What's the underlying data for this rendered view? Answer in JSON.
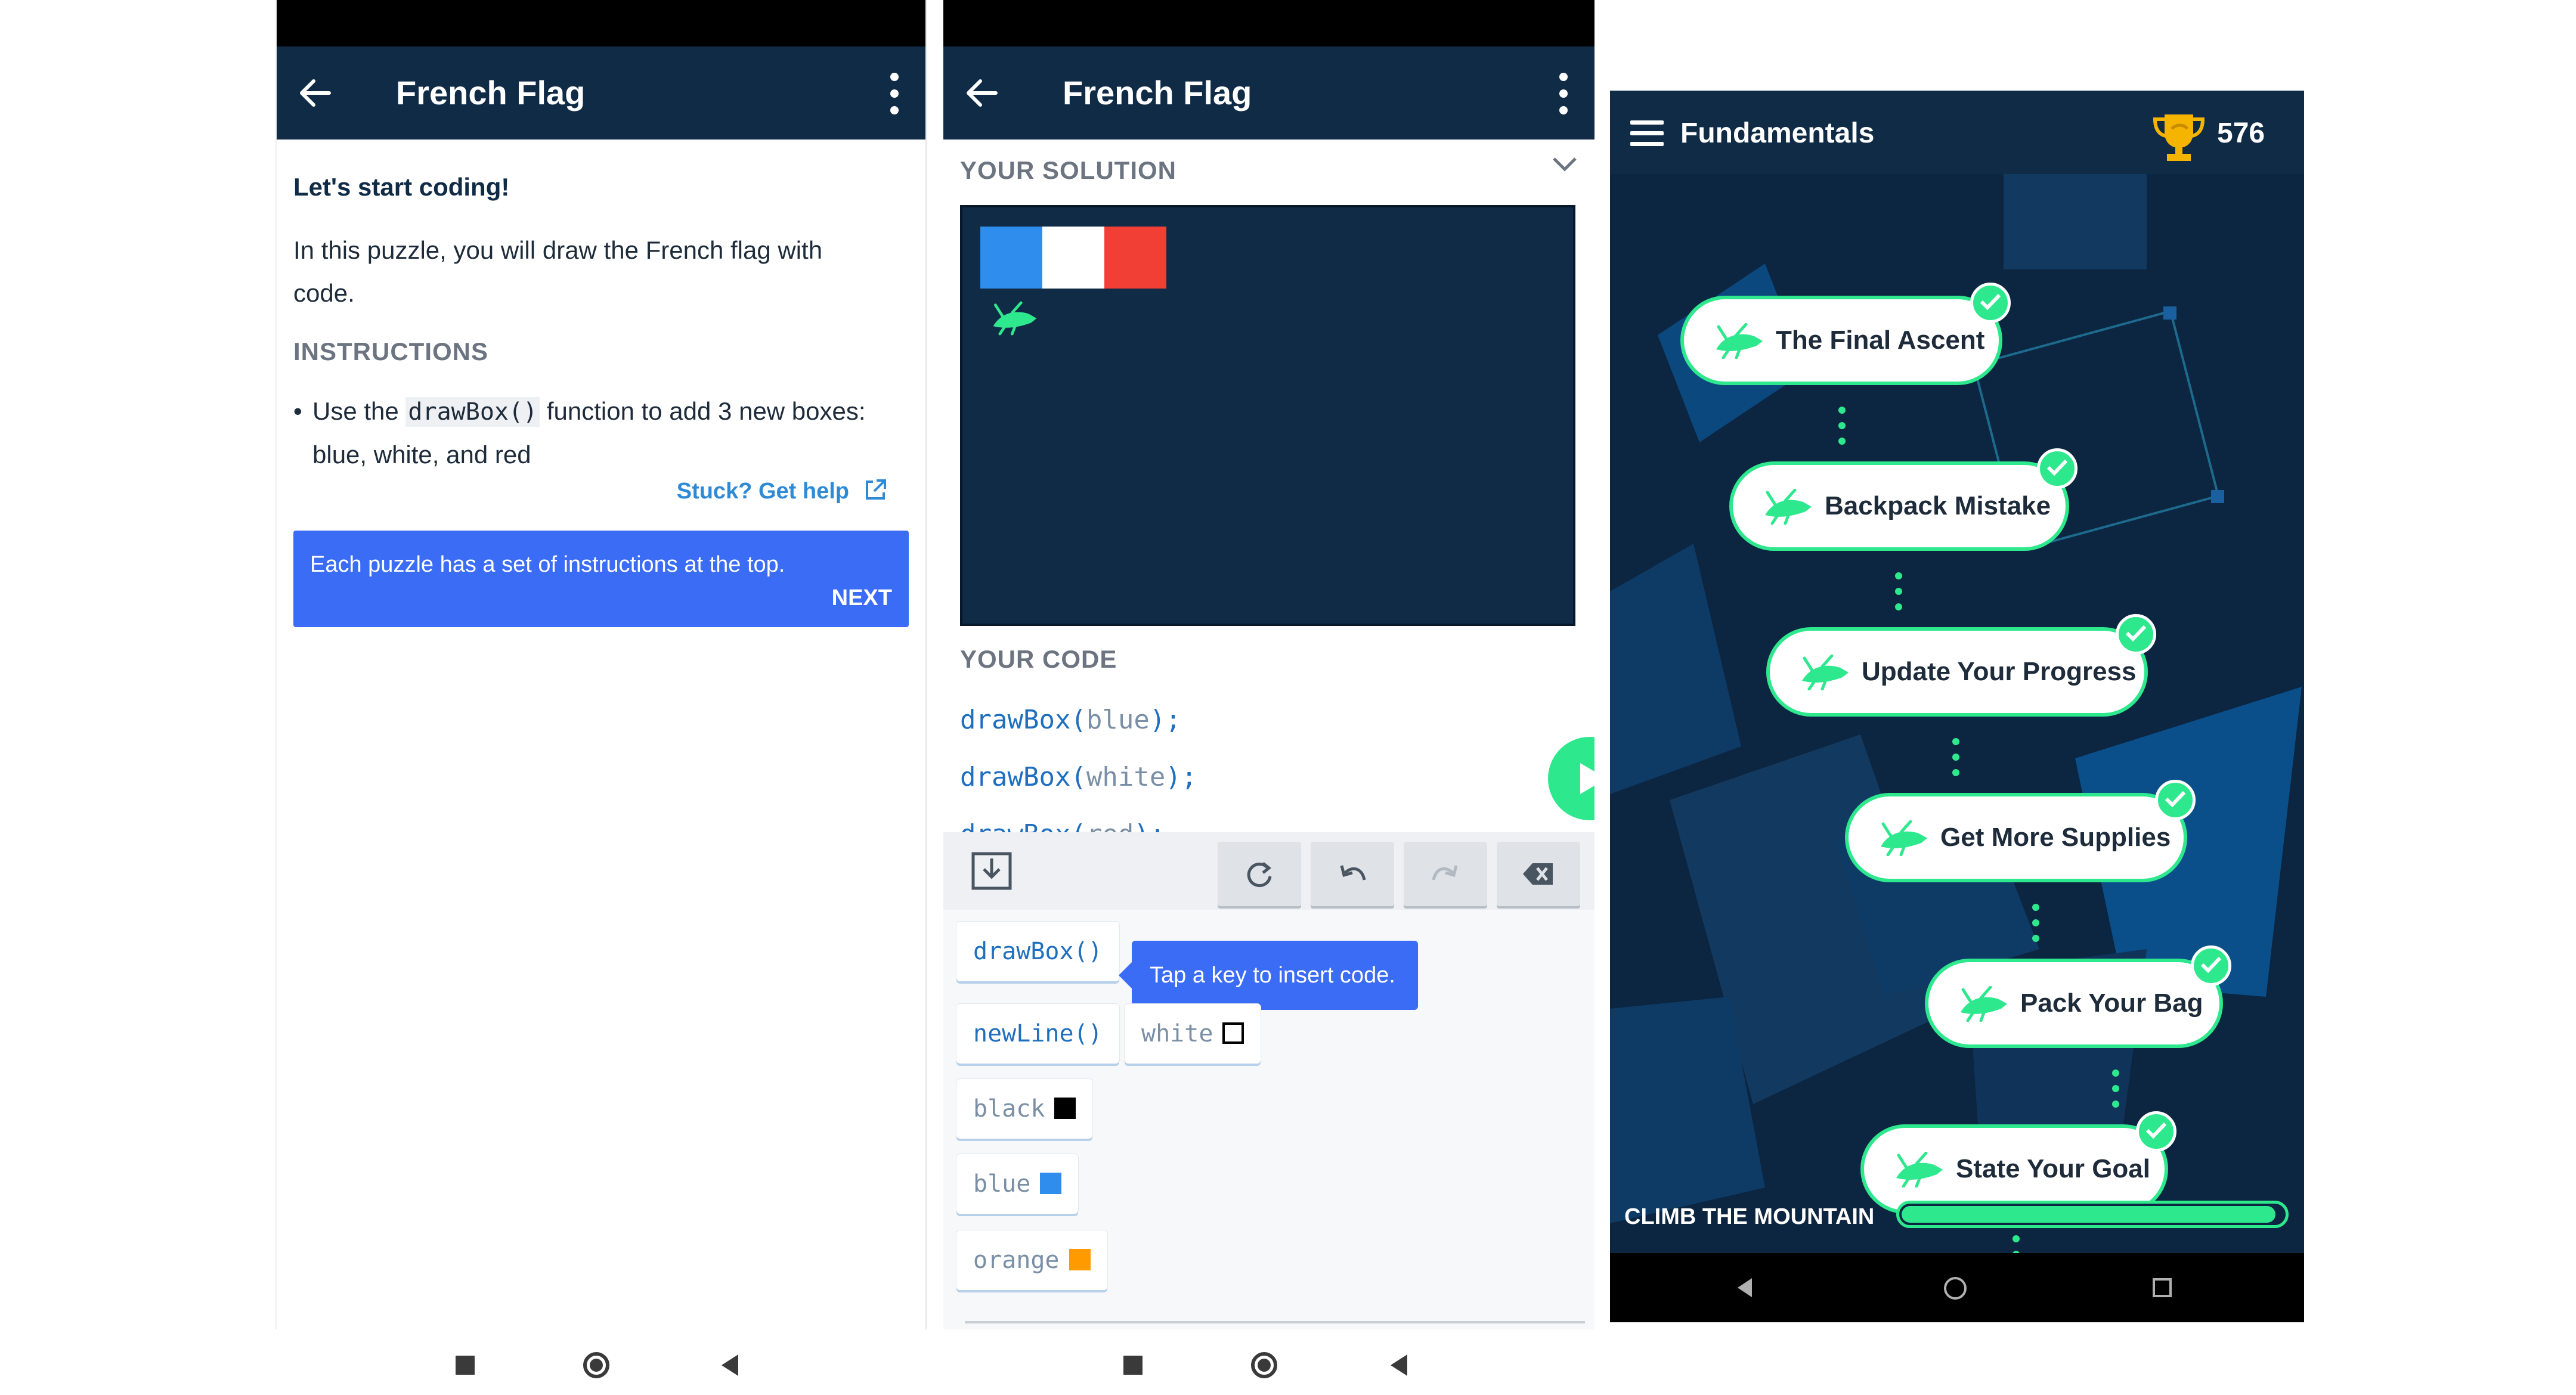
{
  "screen1": {
    "title": "French Flag",
    "heading": "Let's start coding!",
    "intro": "In this puzzle, you will draw the French flag with code.",
    "instructions_header": "INSTRUCTIONS",
    "bullet_prefix": "Use the ",
    "bullet_code": "drawBox()",
    "bullet_suffix": " function to add 3 new boxes: blue, white, and red",
    "stuck_link": "Stuck? Get help",
    "tooltip_message": "Each puzzle has a set of instructions at the top.",
    "tooltip_next": "NEXT"
  },
  "screen2": {
    "title": "French Flag",
    "solution_header": "YOUR SOLUTION",
    "code_header": "YOUR CODE",
    "flag_colors": [
      "#2f8ded",
      "#ffffff",
      "#f23f36"
    ],
    "code_lines": [
      {
        "fn": "drawBox(",
        "arg": "blue",
        "end": ");"
      },
      {
        "fn": "drawBox(",
        "arg": "white",
        "end": ");"
      },
      {
        "fn": "drawBox(",
        "arg": "red",
        "end": ");"
      }
    ],
    "keys": {
      "drawBox": "drawBox()",
      "newLine": "newLine()",
      "white": "white",
      "black": "black",
      "blue": "blue",
      "orange": "orange"
    },
    "key_tooltip": "Tap a key to insert code.",
    "colors": {
      "white": "#ffffff",
      "black": "#000000",
      "blue": "#2f8ded",
      "orange": "#ff9a00"
    }
  },
  "screen3": {
    "title": "Fundamentals",
    "score": "576",
    "lessons": [
      "The Final Ascent",
      "Backpack Mistake",
      "Update Your Progress",
      "Get More Supplies",
      "Pack Your Bag",
      "State Your Goal"
    ],
    "footer_label": "CLIMB THE MOUNTAIN",
    "progress": 0.98,
    "accent": "#2ee88e"
  }
}
